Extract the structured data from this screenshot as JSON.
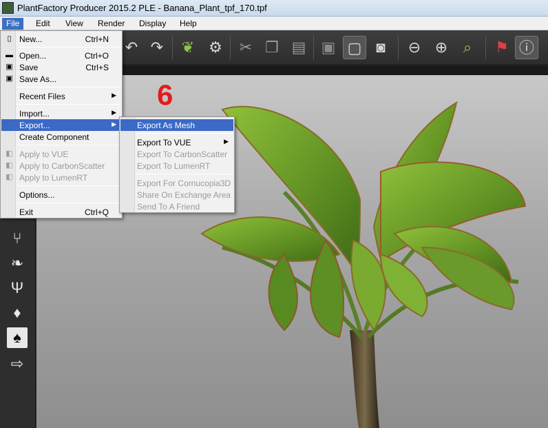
{
  "window": {
    "title": "PlantFactory Producer 2015.2 PLE - Banana_Plant_tpf_170.tpf"
  },
  "menubar": {
    "file": "File",
    "edit": "Edit",
    "view": "View",
    "render": "Render",
    "display": "Display",
    "help": "Help"
  },
  "file_menu": {
    "new": {
      "label": "New...",
      "shortcut": "Ctrl+N"
    },
    "open": {
      "label": "Open...",
      "shortcut": "Ctrl+O"
    },
    "save": {
      "label": "Save",
      "shortcut": "Ctrl+S"
    },
    "save_as": {
      "label": "Save As..."
    },
    "recent_files": {
      "label": "Recent Files"
    },
    "import": {
      "label": "Import..."
    },
    "export": {
      "label": "Export..."
    },
    "create_component": {
      "label": "Create Component"
    },
    "apply_vue": {
      "label": "Apply to VUE"
    },
    "apply_carbonscatter": {
      "label": "Apply to CarbonScatter"
    },
    "apply_lumenrt": {
      "label": "Apply to LumenRT"
    },
    "options": {
      "label": "Options..."
    },
    "exit": {
      "label": "Exit",
      "shortcut": "Ctrl+Q"
    }
  },
  "export_menu": {
    "export_as_mesh": "Export As Mesh",
    "export_to_vue": "Export To VUE",
    "export_to_carbonscatter": "Export To CarbonScatter",
    "export_to_lumenrt": "Export To LumenRT",
    "export_for_cornucopia3d": "Export For Cornucopia3D",
    "share_on_exchange_area": "Share On Exchange Area",
    "send_to_a_friend": "Send To A Friend"
  },
  "annotation": {
    "step_number": "6"
  },
  "colors": {
    "accent": "#3b69c6",
    "step": "#e31b1b",
    "leaf": "#6f9e2e"
  }
}
